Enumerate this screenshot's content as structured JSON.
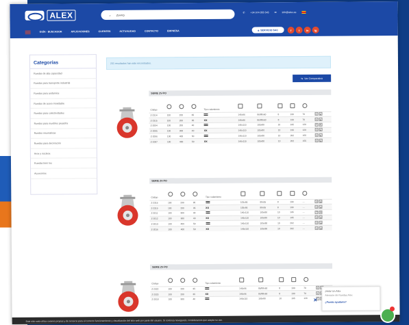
{
  "header": {
    "logo_text": "ALEX",
    "search_value": "ZV-PO",
    "phone": "+34 974 055 545",
    "email": "info@alex.es",
    "sac_label": "SERVICIO SAC",
    "social": [
      "f",
      "t",
      "in",
      "ig"
    ]
  },
  "nav": {
    "items": [
      "GUÍA · BUSCADOR",
      "APLICACIONES",
      "CLIENTES",
      "ACTUALIDAD",
      "CONTACTO",
      "EMPRESA"
    ]
  },
  "sidebar": {
    "title": "Categorías",
    "items": [
      "Ruedas de alta capacidad",
      "Ruedas para transporte industrial",
      "Ruedas para andamios",
      "Ruedas de acero inoxidable",
      "Ruedas para colectividades",
      "Ruedas para muebles pesados",
      "Ruedas neumáticas",
      "Ruedas para decoración",
      "Aros y núcleos",
      "Ruedas tiem los",
      "Accesorios"
    ]
  },
  "main": {
    "notice": "231 resultados han sido encontrados.",
    "compare_label": "Ver Comparativa",
    "code_header": "Código",
    "type_header": "Tipo rodamiento",
    "series": [
      {
        "title": "SERIE ZV-PO",
        "rows": [
          [
            "Z-2314",
            "100",
            "200",
            "35",
            "bar",
            "146x96",
            "86/88x60",
            "8",
            "133",
            "70"
          ],
          [
            "Z-2315",
            "100",
            "200",
            "35",
            "xx",
            "146x96",
            "86/88x60",
            "8",
            "133",
            "70"
          ],
          [
            "Z-2004",
            "100",
            "200",
            "40",
            "bar",
            "146x110",
            "105x80",
            "10",
            "195",
            "120"
          ],
          [
            "Z-2005",
            "100",
            "300",
            "40",
            "xx",
            "146x110",
            "105x80",
            "10",
            "195",
            "120"
          ],
          [
            "Z-2006",
            "100",
            "400",
            "50",
            "bar",
            "146x110",
            "105x80",
            "10",
            "202",
            "155"
          ],
          [
            "Z-2007",
            "100",
            "400",
            "50",
            "xx",
            "146x110",
            "105x80",
            "10",
            "202",
            "155"
          ]
        ]
      },
      {
        "title": "SERIE ZV-PO",
        "rows": [
          [
            "Z-2316",
            "100",
            "200",
            "35",
            "bar",
            "105x86",
            "80x65",
            "8",
            "133",
            "—"
          ],
          [
            "Z-2319",
            "100",
            "200",
            "35",
            "xx",
            "105x86",
            "80x65",
            "8",
            "133",
            "—"
          ],
          [
            "Z-2011",
            "100",
            "300",
            "40",
            "bar",
            "146x110",
            "105x80",
            "10",
            "195",
            "—"
          ],
          [
            "Z-2012",
            "100",
            "300",
            "40",
            "xx",
            "146x110",
            "105x80",
            "10",
            "195",
            "—"
          ],
          [
            "Z-2013",
            "100",
            "400",
            "50",
            "bar",
            "146x110",
            "105x80",
            "10",
            "202",
            "—"
          ],
          [
            "Z-2016",
            "100",
            "400",
            "50",
            "xx",
            "146x110",
            "105x80",
            "10",
            "202",
            "—"
          ]
        ]
      },
      {
        "title": "SERIE ZV-PO",
        "rows": [
          [
            "Z-2322",
            "100",
            "200",
            "35",
            "bar",
            "146x96",
            "86/88x60",
            "8",
            "133",
            "70"
          ],
          [
            "Z-2323",
            "100",
            "200",
            "35",
            "xx",
            "146x96",
            "86/88x60",
            "8",
            "133",
            "70"
          ],
          [
            "Z-2018",
            "100",
            "300",
            "40",
            "bar",
            "146x110",
            "105x80",
            "10",
            "195",
            "120"
          ]
        ]
      }
    ]
  },
  "chat": {
    "greeting": "¡Hola! Un Alex",
    "subtitle": "Atención de Ruedas Alex",
    "question": "¿Puedo ayudarte?"
  },
  "cookie_text": "Este sitio web utiliza cookies propias y de terceros para el correcto funcionamiento y visualización del sitio web por parte del usuario. Si continúa navegando, consideramos que acepta su uso.",
  "colors": {
    "brand_blue": "#1c49a6",
    "accent_red": "#e14b2f",
    "wheel_red": "#d9362b"
  }
}
